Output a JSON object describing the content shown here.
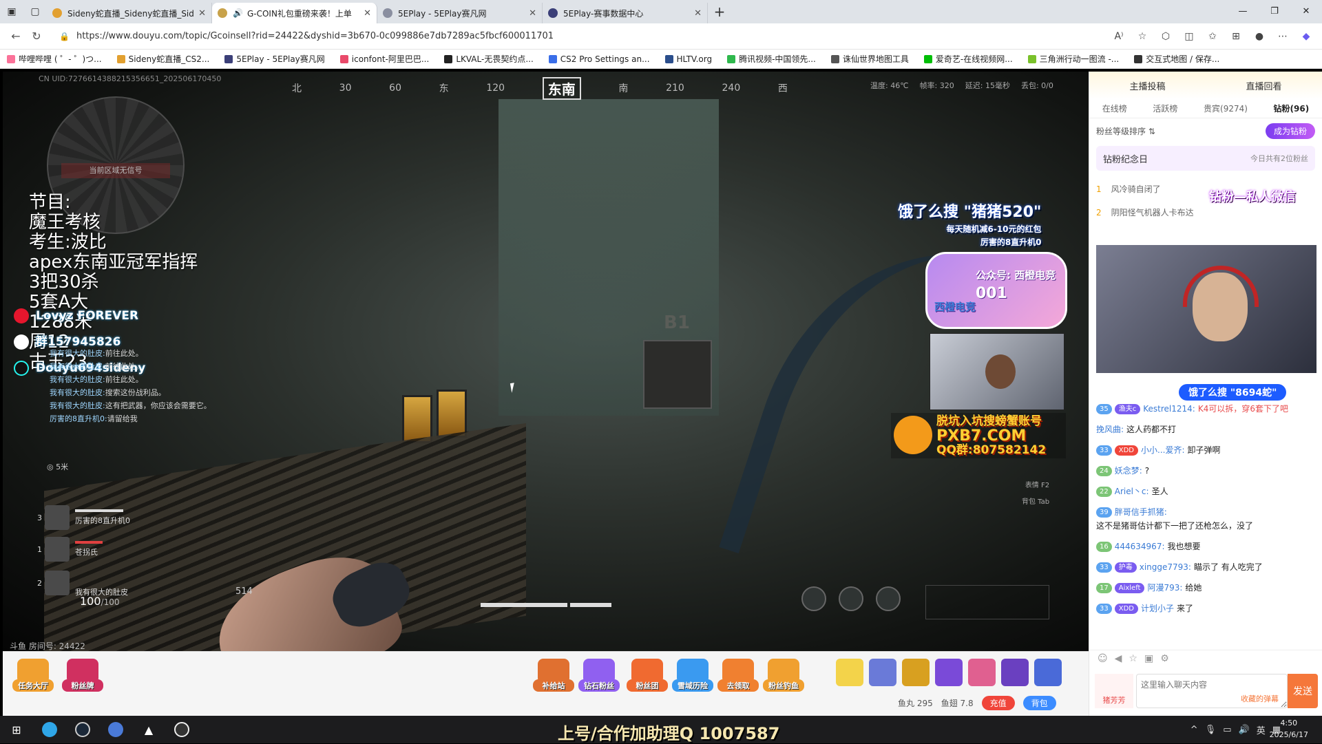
{
  "browser": {
    "tabs": [
      {
        "title": "Sideny蛇直播_Sideny蛇直播_Side",
        "color": "#e2a030"
      },
      {
        "title": "G-COIN礼包重磅来袭！上单",
        "color": "#c8a24a",
        "active": true
      },
      {
        "title": "5EPlay - 5EPlay赛凡网",
        "color": "#8a8fa0"
      },
      {
        "title": "5EPlay-赛事数据中心",
        "color": "#3b3f78"
      }
    ],
    "url": "https://www.douyu.com/topic/Gcoinsell?rid=24422&dyshid=3b670-0c099886e7db7289ac5fbcf600011701",
    "bookmarks": [
      {
        "label": "哔哩哔哩 ( ゜- ゜)つ...",
        "color": "#fb7299"
      },
      {
        "label": "Sideny蛇直播_CS2...",
        "color": "#e2a030"
      },
      {
        "label": "5EPlay - 5EPlay赛凡网",
        "color": "#3b3f78"
      },
      {
        "label": "iconfont-阿里巴巴...",
        "color": "#e94a6a"
      },
      {
        "label": "LKVAL-无畏契约点...",
        "color": "#222"
      },
      {
        "label": "CS2 Pro Settings an...",
        "color": "#3a6ee8"
      },
      {
        "label": "HLTV.org",
        "color": "#2b4e8c"
      },
      {
        "label": "腾讯视频-中国领先...",
        "color": "#2fb84d"
      },
      {
        "label": "诛仙世界地图工具",
        "color": "#555"
      },
      {
        "label": "爱奇艺-在线视频网...",
        "color": "#00be06"
      },
      {
        "label": "三角洲行动一图流 -...",
        "color": "#7ac12b"
      },
      {
        "label": "交互式地图 / 保存...",
        "color": "#333"
      }
    ]
  },
  "stream": {
    "uid": "CN UID:7276614388215356651_20250617045​0",
    "compass": [
      "北",
      "30",
      "60",
      "东",
      "120",
      "东南",
      "南",
      "210",
      "240",
      "西"
    ],
    "topstats": [
      "温度: 46℃",
      "帧率: 320",
      "延迟: 15毫秒",
      "丢包: 0/0"
    ],
    "radar_label": "当前区域无信号",
    "overlay_lines": [
      "节目:",
      "魔王考核",
      "考生:波比",
      "apex东南亚冠军指挥",
      "3把30杀",
      "5套A大",
      "1288米",
      "周12",
      "古玉23"
    ],
    "social": [
      "Lovyz FOREVER",
      "群157945826",
      "Douyu694sideny"
    ],
    "killfeed": [
      {
        "who": "我有很大的肚皮:",
        "what": "前往此处。"
      },
      {
        "who": "我有很大的肚皮:",
        "what": "前往此处。"
      },
      {
        "who": "我有很大的肚皮:",
        "what": "前往此处。"
      },
      {
        "who": "我有很大的肚皮:",
        "what": "搜索这份战利品。"
      },
      {
        "who": "我有很大的肚皮:",
        "what": "这有把武器，你应该会需要它。"
      },
      {
        "who": "厉害的8直升机0:",
        "what": "请留给我"
      }
    ],
    "ad1": {
      "title": "饿了么搜 \"猪猪520\"",
      "sub": "每天随机减6-10元的红包"
    },
    "ad1_note": "厉害的8直升机0",
    "ad2": {
      "line1": "公众号: 西橙电竞",
      "code": "001",
      "name": "西橙电竞"
    },
    "ad3": {
      "line1": "脱坑入坑搜螃蟹账号",
      "line2": "PXB7.COM",
      "line3": "QQ群:807582142"
    },
    "hud_right": [
      "表情 F2",
      "背包 Tab"
    ],
    "squad": [
      {
        "num": "3",
        "name": "厉害的8直升机0"
      },
      {
        "num": "1",
        "name": "苍拐氏"
      },
      {
        "num": "2",
        "name": "我有很大的肚皮"
      }
    ],
    "hp": "100",
    "hp_max": "/100",
    "ammo": "514",
    "ping_text": "5米",
    "room": "斗鱼 房间号: 24422"
  },
  "giftbar": {
    "items": [
      {
        "label": "任务大厅",
        "color": "#f0a030"
      },
      {
        "label": "粉丝牌",
        "color": "#d03060"
      },
      {
        "label": "补给站",
        "color": "#e07030"
      },
      {
        "label": "钻石粉丝",
        "color": "#9060f0"
      },
      {
        "label": "粉丝团",
        "color": "#f06a30"
      },
      {
        "label": "雪域历险",
        "color": "#3a9af0"
      },
      {
        "label": "去领取",
        "color": "#f08030"
      },
      {
        "label": "粉丝钓鱼",
        "color": "#f0a030"
      }
    ],
    "fishball": "鱼丸 295",
    "fishwing": "鱼翅 7.8",
    "charge": "充值",
    "bag": "背包"
  },
  "panel": {
    "top": [
      "主播投稿",
      "直播回看"
    ],
    "tabs": [
      "在线榜",
      "活跃榜",
      "贵宾(9274)",
      "钻粉(96)"
    ],
    "rank_label": "粉丝等级排序 ⇅",
    "become_fan": "成为钻粉",
    "anniv_title": "钻粉纪念日",
    "anniv_sub": "今日共有2位粉丝",
    "list": [
      {
        "n": "1",
        "name": "风冷骑自闭了"
      },
      {
        "n": "2",
        "name": "阴阳怪气机器人卡布达"
      }
    ],
    "wx_banner": "钻粉—私人微信",
    "wx_pill": "饿了么搜 \"8694蛇\"",
    "chat": [
      {
        "lv": "35",
        "badge": "渔夫c",
        "name": "Kestrel1214:",
        "text": "K4可以拆，穿6套下了吧",
        "red": true
      },
      {
        "lv": "",
        "badge": "",
        "name": "挽风曲:",
        "text": "这人药都不打"
      },
      {
        "lv": "33",
        "badge": "XDD",
        "name": "小小...爱齐:",
        "text": "卸子弹啊",
        "badgeRed": true
      },
      {
        "lv": "24",
        "badge": "",
        "name": "妖念梦:",
        "text": "?",
        "green": true
      },
      {
        "lv": "22",
        "badge": "",
        "name": "Ariel丶c:",
        "text": "圣人",
        "green": true
      },
      {
        "lv": "39",
        "badge": "",
        "name": "胖哥信手抓猪:",
        "text": "这不是猪哥估计都下一把了还枪怎么，没了"
      },
      {
        "lv": "16",
        "badge": "",
        "name": "444634967:",
        "text": "我也想要",
        "green": true
      },
      {
        "lv": "33",
        "badge": "护毒",
        "name": "xingge7793:",
        "text": "瞄示了 有人吃完了"
      },
      {
        "lv": "17",
        "badge": "Aixleft",
        "name": "阿漫793:",
        "text": "给她",
        "green": true
      },
      {
        "lv": "33",
        "badge": "XDD",
        "name": "计划小子",
        "text": "来了"
      }
    ],
    "input_placeholder": "这里输入聊天内容",
    "input_hint": "收藏的弹幕",
    "send": "发送",
    "ava_label": "猪芳芳"
  },
  "taskbar": {
    "banner": "上号/合作加助理Q 1007587",
    "time": "4:50",
    "date": "2025/6/17",
    "ime": "英"
  }
}
